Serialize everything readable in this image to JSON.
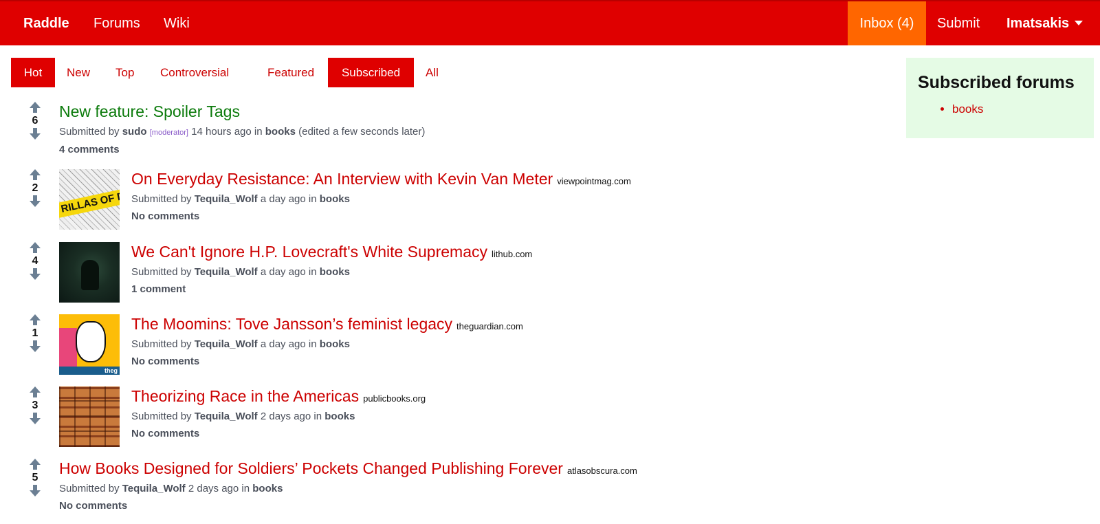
{
  "navbar": {
    "brand": "Raddle",
    "forums": "Forums",
    "wiki": "Wiki",
    "inbox": "Inbox (4)",
    "submit": "Submit",
    "user": "Imatsakis",
    "accent_color": "#df0000",
    "inbox_color": "#ff6600"
  },
  "tabs": {
    "hot": "Hot",
    "new": "New",
    "top": "Top",
    "controversial": "Controversial",
    "featured": "Featured",
    "subscribed": "Subscribed",
    "all": "All"
  },
  "sidebar": {
    "title": "Subscribed forums",
    "forums": [
      "books"
    ]
  },
  "posts": [
    {
      "score": "6",
      "title": "New feature: Spoiler Tags",
      "domain": "",
      "submitted_by": "Submitted by",
      "author": "sudo",
      "author_tag": "[moderator]",
      "time": "14 hours ago",
      "in_label": "in",
      "forum": "books",
      "edited": "(edited a few seconds later)",
      "comments": "4 comments"
    },
    {
      "score": "2",
      "title": "On Everyday Resistance: An Interview with Kevin Van Meter",
      "domain": "viewpointmag.com",
      "submitted_by": "Submitted by",
      "author": "Tequila_Wolf",
      "time": "a day ago",
      "in_label": "in",
      "forum": "books",
      "comments": "No comments",
      "thumb_text": "RILLAS OF DI"
    },
    {
      "score": "4",
      "title": "We Can't Ignore H.P. Lovecraft's White Supremacy",
      "domain": "lithub.com",
      "submitted_by": "Submitted by",
      "author": "Tequila_Wolf",
      "time": "a day ago",
      "in_label": "in",
      "forum": "books",
      "comments": "1 comment"
    },
    {
      "score": "1",
      "title": "The Moomins: Tove Jansson’s feminist legacy",
      "domain": "theguardian.com",
      "submitted_by": "Submitted by",
      "author": "Tequila_Wolf",
      "time": "a day ago",
      "in_label": "in",
      "forum": "books",
      "comments": "No comments",
      "thumb_text": "theg"
    },
    {
      "score": "3",
      "title": "Theorizing Race in the Americas",
      "domain": "publicbooks.org",
      "submitted_by": "Submitted by",
      "author": "Tequila_Wolf",
      "time": "2 days ago",
      "in_label": "in",
      "forum": "books",
      "comments": "No comments"
    },
    {
      "score": "5",
      "title": "How Books Designed for Soldiers’ Pockets Changed Publishing Forever",
      "domain": "atlasobscura.com",
      "submitted_by": "Submitted by",
      "author": "Tequila_Wolf",
      "time": "2 days ago",
      "in_label": "in",
      "forum": "books",
      "comments": "No comments"
    }
  ]
}
